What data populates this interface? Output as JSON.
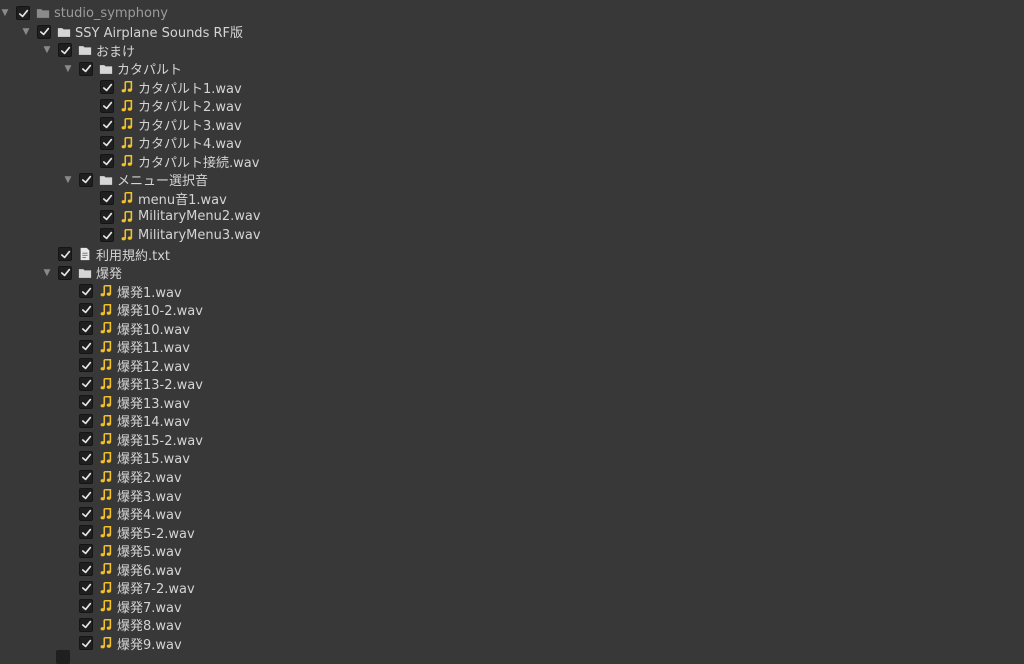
{
  "colors": {
    "background": "#383838",
    "text": "#d4d4d4",
    "muted_text": "#9c9c9c",
    "audio_icon": "#f3c12a",
    "folder_icon": "#d6d6d6",
    "checkbox_bg": "#1f1f1f"
  },
  "tree": [
    {
      "label": "studio_symphony",
      "depth": 0,
      "type": "folder",
      "expanded": true,
      "checked": true,
      "muted": true
    },
    {
      "label": "SSY Airplane Sounds RF版",
      "depth": 1,
      "type": "folder",
      "expanded": true,
      "checked": true
    },
    {
      "label": "おまけ",
      "depth": 2,
      "type": "folder",
      "expanded": true,
      "checked": true
    },
    {
      "label": "カタパルト",
      "depth": 3,
      "type": "folder",
      "expanded": true,
      "checked": true
    },
    {
      "label": "カタパルト1.wav",
      "depth": 4,
      "type": "audio",
      "checked": true
    },
    {
      "label": "カタパルト2.wav",
      "depth": 4,
      "type": "audio",
      "checked": true
    },
    {
      "label": "カタパルト3.wav",
      "depth": 4,
      "type": "audio",
      "checked": true
    },
    {
      "label": "カタパルト4.wav",
      "depth": 4,
      "type": "audio",
      "checked": true
    },
    {
      "label": "カタパルト接続.wav",
      "depth": 4,
      "type": "audio",
      "checked": true
    },
    {
      "label": "メニュー選択音",
      "depth": 3,
      "type": "folder",
      "expanded": true,
      "checked": true
    },
    {
      "label": "menu音1.wav",
      "depth": 4,
      "type": "audio",
      "checked": true
    },
    {
      "label": "MilitaryMenu2.wav",
      "depth": 4,
      "type": "audio",
      "checked": true
    },
    {
      "label": "MilitaryMenu3.wav",
      "depth": 4,
      "type": "audio",
      "checked": true
    },
    {
      "label": "利用規約.txt",
      "depth": 2,
      "type": "text",
      "checked": true
    },
    {
      "label": "爆発",
      "depth": 2,
      "type": "folder",
      "expanded": true,
      "checked": true
    },
    {
      "label": "爆発1.wav",
      "depth": 3,
      "type": "audio",
      "checked": true
    },
    {
      "label": "爆発10-2.wav",
      "depth": 3,
      "type": "audio",
      "checked": true
    },
    {
      "label": "爆発10.wav",
      "depth": 3,
      "type": "audio",
      "checked": true
    },
    {
      "label": "爆発11.wav",
      "depth": 3,
      "type": "audio",
      "checked": true
    },
    {
      "label": "爆発12.wav",
      "depth": 3,
      "type": "audio",
      "checked": true
    },
    {
      "label": "爆発13-2.wav",
      "depth": 3,
      "type": "audio",
      "checked": true
    },
    {
      "label": "爆発13.wav",
      "depth": 3,
      "type": "audio",
      "checked": true
    },
    {
      "label": "爆発14.wav",
      "depth": 3,
      "type": "audio",
      "checked": true
    },
    {
      "label": "爆発15-2.wav",
      "depth": 3,
      "type": "audio",
      "checked": true
    },
    {
      "label": "爆発15.wav",
      "depth": 3,
      "type": "audio",
      "checked": true
    },
    {
      "label": "爆発2.wav",
      "depth": 3,
      "type": "audio",
      "checked": true
    },
    {
      "label": "爆発3.wav",
      "depth": 3,
      "type": "audio",
      "checked": true
    },
    {
      "label": "爆発4.wav",
      "depth": 3,
      "type": "audio",
      "checked": true
    },
    {
      "label": "爆発5-2.wav",
      "depth": 3,
      "type": "audio",
      "checked": true
    },
    {
      "label": "爆発5.wav",
      "depth": 3,
      "type": "audio",
      "checked": true
    },
    {
      "label": "爆発6.wav",
      "depth": 3,
      "type": "audio",
      "checked": true
    },
    {
      "label": "爆発7-2.wav",
      "depth": 3,
      "type": "audio",
      "checked": true
    },
    {
      "label": "爆発7.wav",
      "depth": 3,
      "type": "audio",
      "checked": true
    },
    {
      "label": "爆発8.wav",
      "depth": 3,
      "type": "audio",
      "checked": true
    },
    {
      "label": "爆発9.wav",
      "depth": 3,
      "type": "audio",
      "checked": true
    }
  ]
}
